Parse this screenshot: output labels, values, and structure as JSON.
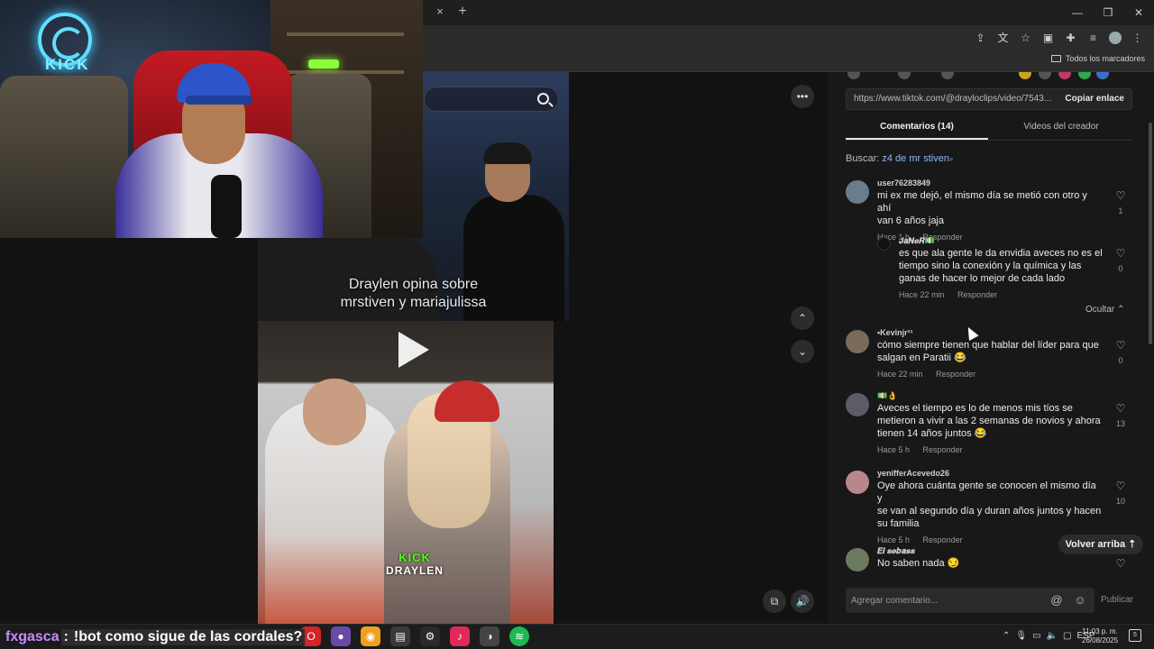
{
  "browser": {
    "new_tab_glyph": "+",
    "close_tab_glyph": "×",
    "window_controls": [
      "—",
      "❐",
      "✕"
    ],
    "bookmarks_all": "Todos los marcadores"
  },
  "webcam": {
    "neon_logo_text": "KICK"
  },
  "video": {
    "caption_line1": "Draylen opina sobre",
    "caption_line2": "mrstiven y mariajulissa",
    "watermark_top": "KICK",
    "watermark_bottom": "DRAYLEN"
  },
  "player_controls": {
    "more_glyph": "•••",
    "up_glyph": "⌃",
    "down_glyph": "⌄",
    "volume_glyph": "🔊",
    "pip_glyph": "⧉"
  },
  "panel": {
    "url": "https://www.tiktok.com/@drayloclips/video/7543...",
    "copy_link": "Copiar enlace",
    "tabs": [
      {
        "label": "Comentarios (14)",
        "active": true
      },
      {
        "label": "Videos del creador",
        "active": false
      }
    ],
    "search_prefix": "Buscar:",
    "search_query": "z4 de mr stiven",
    "comments": [
      {
        "user": "user76283849",
        "text_lines": [
          "mi ex me dejó, el mismo día se metió con otro y ahí",
          "van 6 años jaja"
        ],
        "time": "Hace 1 h",
        "reply": "Responder",
        "likes": "1"
      },
      {
        "user": "𝑱𝒂𝑵𝒆𝑹💵",
        "text_lines": [
          "es que ala gente le da envidia aveces no es el",
          "tiempo sino la conexión y la química y las",
          "ganas de hacer lo mejor de cada lado"
        ],
        "time": "Hace 22 min",
        "reply": "Responder",
        "likes": "0",
        "is_reply": true
      },
      {
        "user": "•Kevinjr¹¹",
        "text_lines": [
          "cómo siempre tienen que hablar del líder para que",
          "salgan en Paratii 😂"
        ],
        "time": "Hace 22 min",
        "reply": "Responder",
        "likes": "0"
      },
      {
        "user": "💵👌",
        "text_lines": [
          "Aveces el tiempo es lo de menos mis tíos se",
          "metieron a vivir a las 2 semanas de novios y ahora",
          "tienen 14 años juntos 😂"
        ],
        "time": "Hace 5 h",
        "reply": "Responder",
        "likes": "13"
      },
      {
        "user": "yenifferAcevedo26",
        "text_lines": [
          "Oye ahora cuánta gente se conocen el mismo día y",
          "se van al segundo día y duran años juntos y hacen",
          "su familia"
        ],
        "time": "Hace 5 h",
        "reply": "Responder",
        "likes": "10"
      },
      {
        "user": "𝑬𝒍 𝒔𝒆𝒃𝒂𝒔𝒔",
        "text_lines": [
          "No saben nada 😏"
        ],
        "time": "",
        "reply": "",
        "likes": ""
      }
    ],
    "hide_replies": "Ocultar ⌃",
    "scroll_top": "Volver arriba ⇡",
    "comment_placeholder": "Agregar comentario...",
    "publish": "Publicar",
    "at_glyph": "@",
    "emoji_glyph": "☺",
    "heart_glyph": "♡"
  },
  "taskbar": {
    "chat_user": "fxgasca",
    "chat_sep": ":",
    "chat_message": "!bot como sigue de las cordales?",
    "lang": "ESP",
    "time": "11:03 p. m.",
    "date": "26/08/2025",
    "notification_count": "5"
  },
  "colors": {
    "kick_green": "#53fc18",
    "chat_user": "#c58bff",
    "panel_bg": "#181818"
  }
}
